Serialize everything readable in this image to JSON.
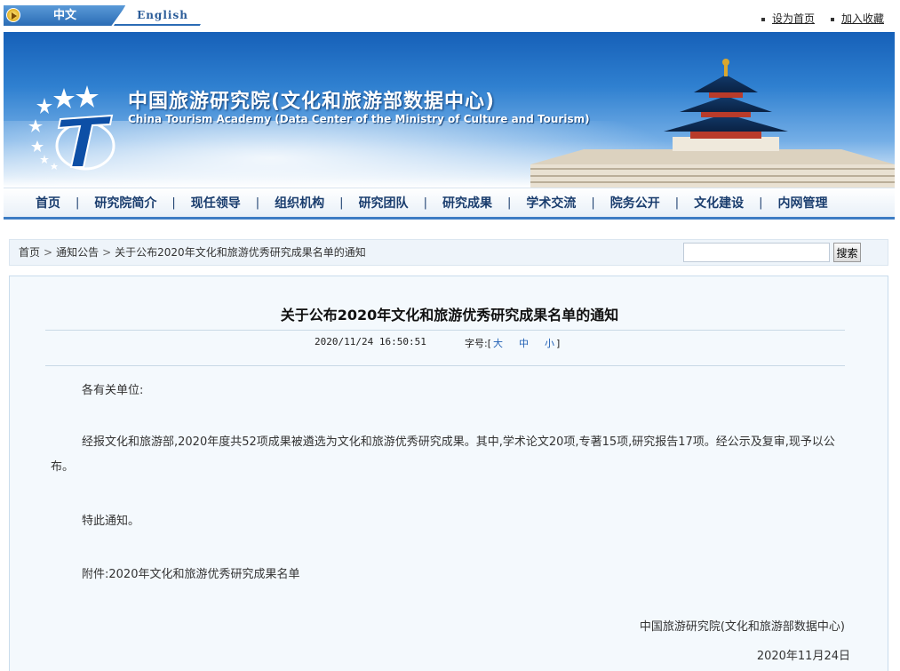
{
  "top": {
    "lang_zh": "中文",
    "lang_en": "English",
    "set_home": "设为首页",
    "add_fav": "加入收藏"
  },
  "banner": {
    "name_cn": "中国旅游研究院(文化和旅游部数据中心)",
    "name_en": "China Tourism Academy (Data Center of the Ministry of Culture and Tourism)"
  },
  "nav": [
    "首页",
    "研究院简介",
    "现任领导",
    "组织机构",
    "研究团队",
    "研究成果",
    "学术交流",
    "院务公开",
    "文化建设",
    "内网管理"
  ],
  "breadcrumb": {
    "home": "首页",
    "section": "通知公告",
    "current": "关于公布2020年文化和旅游优秀研究成果名单的通知"
  },
  "search": {
    "placeholder": "",
    "button": "搜索"
  },
  "article": {
    "title": "关于公布2020年文化和旅游优秀研究成果名单的通知",
    "datetime": "2020/11/24 16:50:51",
    "fontsize_label": "字号:[",
    "fontsize_large": "大",
    "fontsize_medium": "中",
    "fontsize_small": "小",
    "fontsize_close": "]",
    "greeting": "各有关单位:",
    "paragraph": "经报文化和旅游部,2020年度共52项成果被遴选为文化和旅游优秀研究成果。其中,学术论文20项,专著15项,研究报告17项。经公示及复审,现予以公布。",
    "closing": "特此通知。",
    "attachment": "附件:2020年文化和旅游优秀研究成果名单",
    "signature": "中国旅游研究院(文化和旅游部数据中心)",
    "sign_date": "2020年11月24日"
  },
  "colors": {
    "brand_blue": "#2b6cb5",
    "nav_text": "#1a3d6e",
    "content_bg": "#f4f9fd"
  }
}
